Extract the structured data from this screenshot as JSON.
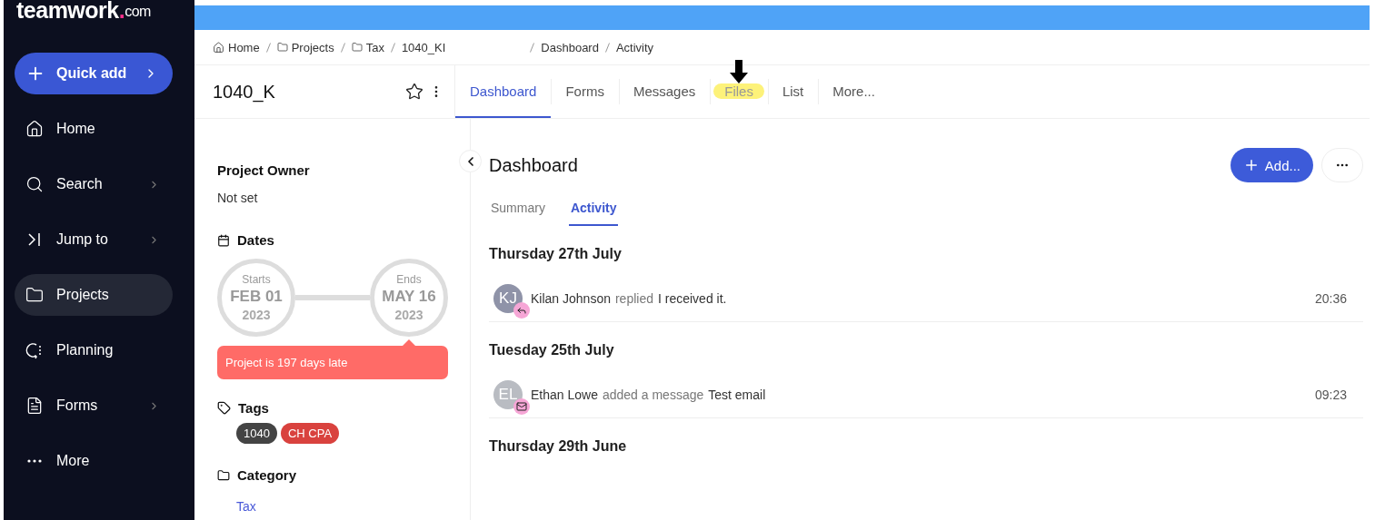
{
  "sidebar": {
    "logo": {
      "word": "teamwork",
      "dot": ".",
      "suffix": "com"
    },
    "quick_add": {
      "label": "Quick add"
    },
    "items": [
      {
        "label": "Home",
        "selected": false,
        "submenu": false
      },
      {
        "label": "Search",
        "selected": false,
        "submenu": true
      },
      {
        "label": "Jump to",
        "selected": false,
        "submenu": true
      },
      {
        "label": "Projects",
        "selected": true,
        "submenu": false
      },
      {
        "label": "Planning",
        "selected": false,
        "submenu": false
      },
      {
        "label": "Forms",
        "selected": false,
        "submenu": true
      },
      {
        "label": "More",
        "selected": false,
        "submenu": false
      }
    ]
  },
  "breadcrumbs": {
    "trail": [
      "Home",
      "Projects",
      "Tax",
      "1040_KI"
    ],
    "trail_end": [
      "Dashboard",
      "Activity"
    ]
  },
  "project": {
    "title": "1040_K"
  },
  "tabs": [
    {
      "label": "Dashboard",
      "selected": true,
      "highlighted": false
    },
    {
      "label": "Forms",
      "selected": false,
      "highlighted": false
    },
    {
      "label": "Messages",
      "selected": false,
      "highlighted": false
    },
    {
      "label": "Files",
      "selected": false,
      "highlighted": true
    },
    {
      "label": "List",
      "selected": false,
      "highlighted": false
    },
    {
      "label": "More...",
      "selected": false,
      "highlighted": false
    }
  ],
  "details": {
    "owner": {
      "heading": "Project Owner",
      "value": "Not set"
    },
    "dates": {
      "heading": "Dates",
      "start": {
        "caption": "Starts",
        "day": "FEB 01",
        "year": "2023"
      },
      "end": {
        "caption": "Ends",
        "day": "MAY 16",
        "year": "2023"
      },
      "alert": "Project is 197 days late"
    },
    "tags": {
      "heading": "Tags",
      "items": [
        {
          "label": "1040",
          "color": "#444444"
        },
        {
          "label": "CH CPA",
          "color": "#d9423e"
        }
      ]
    },
    "category": {
      "heading": "Category",
      "value": "Tax"
    }
  },
  "dashboard": {
    "title": "Dashboard",
    "add_button": "Add...",
    "subtabs": [
      {
        "label": "Summary",
        "selected": false
      },
      {
        "label": "Activity",
        "selected": true
      }
    ],
    "groups": [
      {
        "date": "Thursday 27th July",
        "entries": [
          {
            "initials": "KJ",
            "color": "#8f93a8",
            "kind": "reply",
            "name": "Kilan Johnson",
            "action": "replied",
            "text": "I received it.",
            "time": "20:36"
          }
        ]
      },
      {
        "date": "Tuesday 25th July",
        "entries": [
          {
            "initials": "EL",
            "color": "#b9bcc2",
            "kind": "message",
            "name": "Ethan Lowe",
            "action": "added a message",
            "text": "Test email",
            "time": "09:23"
          }
        ]
      },
      {
        "date": "Thursday 29th June"
      }
    ]
  }
}
